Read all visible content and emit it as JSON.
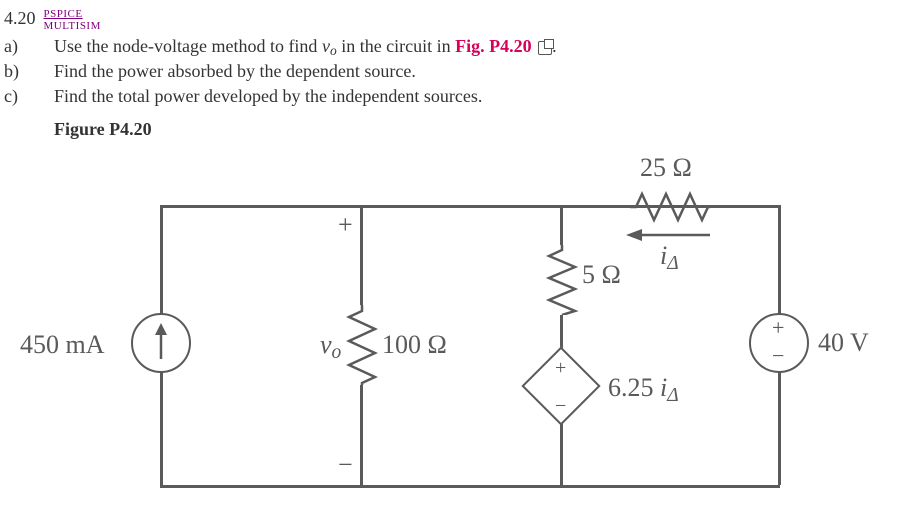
{
  "problem_number": "4.20",
  "sim": {
    "pspice": "PSPICE",
    "multisim": "MULTISIM"
  },
  "questions": {
    "a": {
      "label": "a)",
      "pre": "Use the node-voltage method to find ",
      "var": "v",
      "sub": "o",
      "post": " in the circuit in ",
      "fig": "Fig. P4.20",
      "end": "."
    },
    "b": {
      "label": "b)",
      "text": "Find the power absorbed by the dependent source."
    },
    "c": {
      "label": "c)",
      "text": "Find the total power developed by the independent sources."
    }
  },
  "figure_title": "Figure P4.20",
  "circuit": {
    "isrc": {
      "value": "450 mA"
    },
    "r100": {
      "value": "100 Ω"
    },
    "r5": {
      "value": "5 Ω"
    },
    "r25": {
      "value": "25 Ω"
    },
    "vdep": {
      "value": "6.25 ",
      "var": "i",
      "sub": "Δ"
    },
    "vsrc": {
      "value": "40 V"
    },
    "vo": {
      "var": "v",
      "sub": "o"
    },
    "ia": {
      "var": "i",
      "sub": "Δ"
    },
    "plus": "+",
    "minus": "−"
  }
}
